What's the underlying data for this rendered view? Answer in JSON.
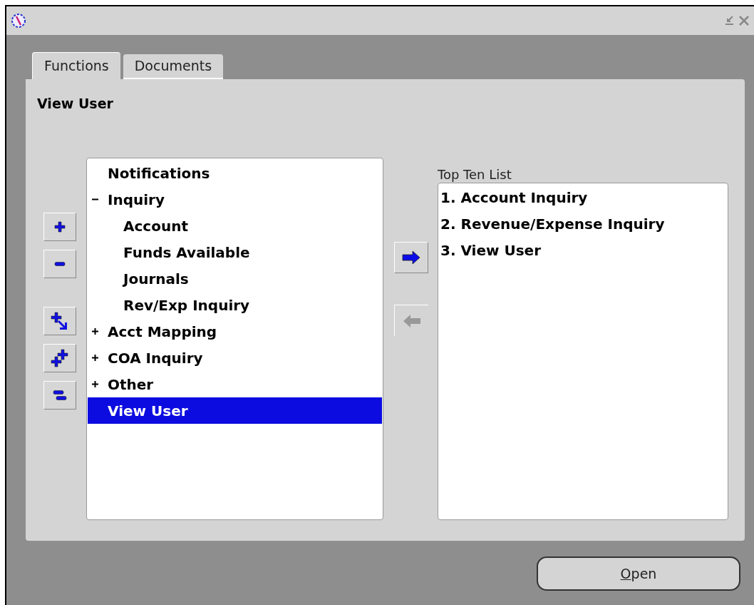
{
  "tabs": [
    {
      "label": "Functions",
      "selected": true
    },
    {
      "label": "Documents",
      "selected": false
    }
  ],
  "heading": "View User",
  "tree": [
    {
      "label": "Notifications",
      "selected": false
    },
    {
      "label": "Inquiry",
      "expanded": true,
      "selected": false,
      "children": [
        {
          "label": "Account",
          "selected": false
        },
        {
          "label": "Funds Available",
          "selected": false
        },
        {
          "label": "Journals",
          "selected": false
        },
        {
          "label": "Rev/Exp Inquiry",
          "selected": false
        }
      ]
    },
    {
      "label": "Acct Mapping",
      "expanded": false,
      "selected": false
    },
    {
      "label": "COA Inquiry",
      "expanded": false,
      "selected": false
    },
    {
      "label": "Other",
      "expanded": false,
      "selected": false
    },
    {
      "label": "View User",
      "selected": true
    }
  ],
  "transfer": [
    {
      "kind": "add",
      "disabled": false
    },
    {
      "kind": "remove",
      "disabled": true
    }
  ],
  "top_ten": {
    "label": "Top Ten List",
    "items": [
      "1. Account Inquiry",
      "2. Revenue/Expense Inquiry",
      "3. View User"
    ]
  },
  "open_button": "Open"
}
